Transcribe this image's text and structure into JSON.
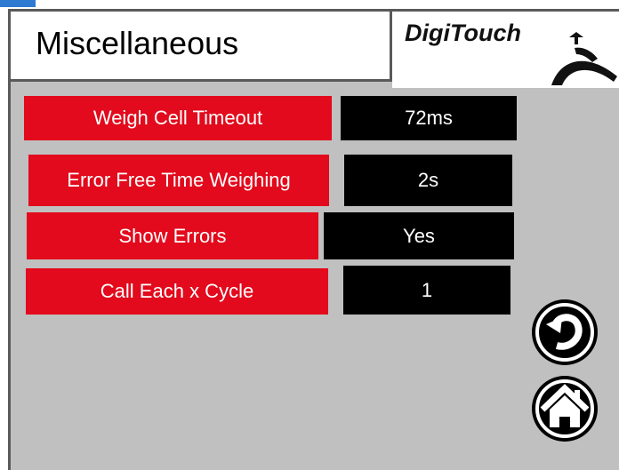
{
  "header": {
    "title": "Miscellaneous",
    "logo_text": "DigiTouch"
  },
  "rows": [
    {
      "label": "Weigh Cell Timeout",
      "value": "72ms"
    },
    {
      "label": "Error Free Time Weighing",
      "value": "2s"
    },
    {
      "label": "Show Errors",
      "value": "Yes"
    },
    {
      "label": "Call Each x Cycle",
      "value": "1"
    }
  ],
  "colors": {
    "label_bg": "#e20a1c",
    "value_bg": "#000000",
    "panel_bg": "#c0c0c0"
  },
  "icons": {
    "back": "back-arrow-icon",
    "home": "home-icon"
  }
}
